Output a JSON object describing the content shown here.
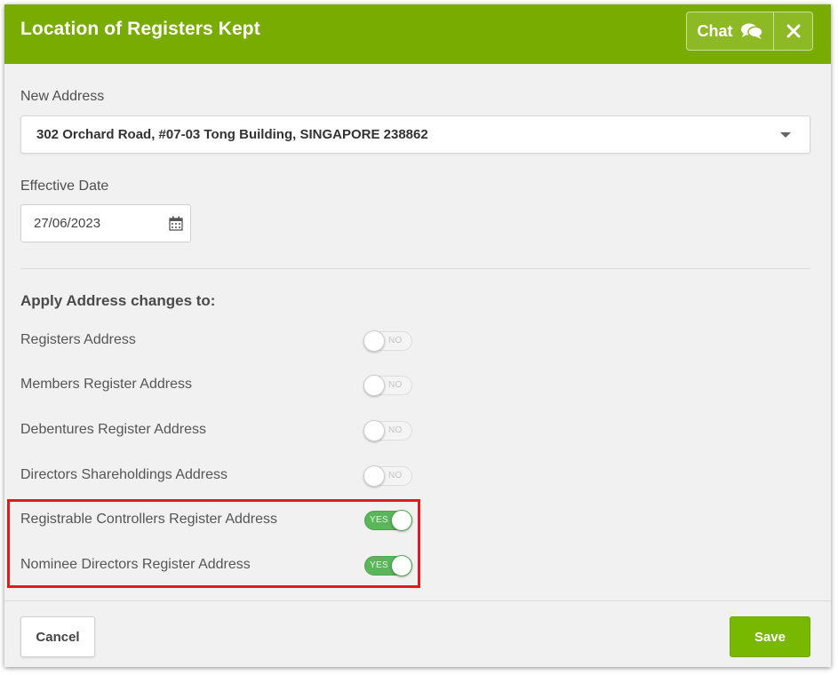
{
  "modal": {
    "title": "Location of Registers Kept",
    "chat_label": "Chat",
    "colors": {
      "header": "#79ac00",
      "toggle_on": "#5bb65b",
      "highlight": "#e4181f",
      "save": "#79b800"
    }
  },
  "icons": {
    "chat": "chat-bubbles-icon",
    "close": "close-icon",
    "calendar": "calendar-icon",
    "dropdown": "caret-down-icon"
  },
  "form": {
    "address_label": "New Address",
    "address_value": "302 Orchard Road, #07-03 Tong Building, SINGAPORE 238862",
    "date_label": "Effective Date",
    "date_value": "27/06/2023",
    "section_title": "Apply Address changes to:",
    "toggles": [
      {
        "label": "Registers Address",
        "state": "NO"
      },
      {
        "label": "Members Register Address",
        "state": "NO"
      },
      {
        "label": "Debentures Register Address",
        "state": "NO"
      },
      {
        "label": "Directors Shareholdings Address",
        "state": "NO"
      },
      {
        "label": "Registrable Controllers Register Address",
        "state": "YES"
      },
      {
        "label": "Nominee Directors Register Address",
        "state": "YES"
      }
    ]
  },
  "footer": {
    "cancel_label": "Cancel",
    "save_label": "Save"
  }
}
